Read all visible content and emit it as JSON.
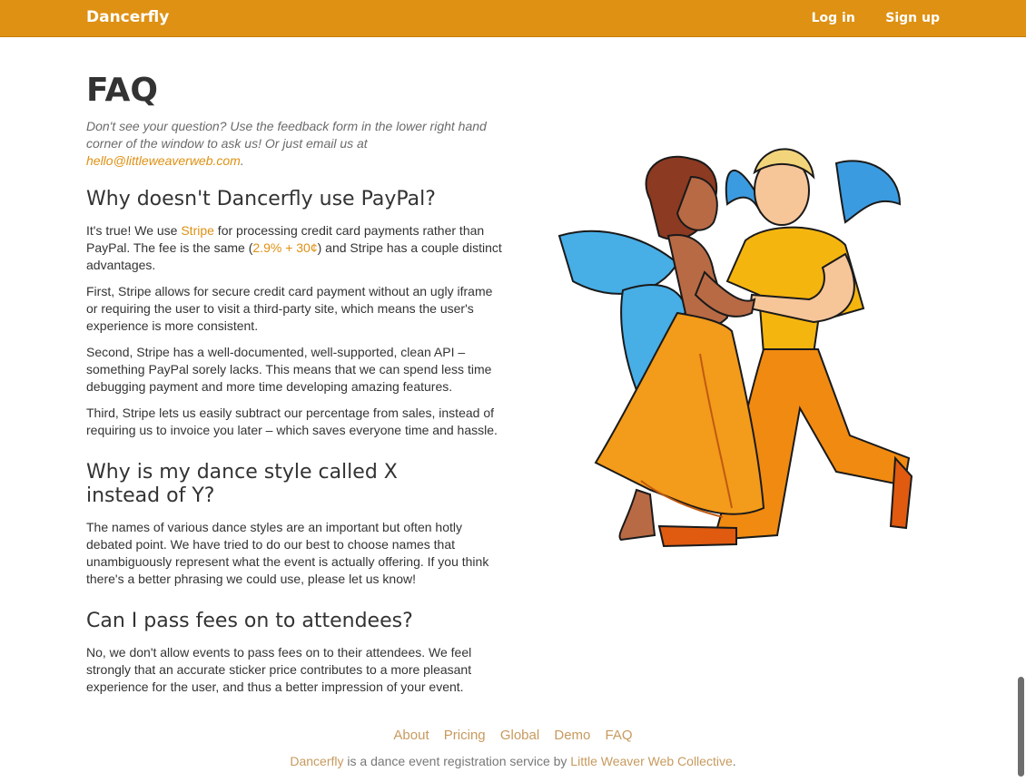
{
  "navbar": {
    "brand": "Dancerfly",
    "login": "Log in",
    "signup": "Sign up",
    "color": "#de9113"
  },
  "page": {
    "title": "FAQ",
    "lead_text": "Don't see your question? Use the feedback form in the lower right hand corner of the window to ask us! Or just email us at ",
    "lead_email": "hello@littleweaverweb.com",
    "lead_end": "."
  },
  "faq": [
    {
      "question": "Why doesn't Dancerfly use PayPal?",
      "p1_a": "It's true! We use ",
      "p1_link": "Stripe",
      "p1_b": " for processing credit card payments rather than PayPal. The fee is the same (",
      "p1_fee": "2.9% + 30¢",
      "p1_c": ") and Stripe has a couple distinct advantages.",
      "p2": "First, Stripe allows for secure credit card payment without an ugly iframe or requiring the user to visit a third-party site, which means the user's experience is more consistent.",
      "p3": "Second, Stripe has a well-documented, well-supported, clean API – something PayPal sorely lacks. This means that we can spend less time debugging payment and more time developing amazing features.",
      "p4": "Third, Stripe lets us easily subtract our percentage from sales, instead of requiring us to invoice you later – which saves everyone time and hassle."
    },
    {
      "question": "Why is my dance style called X instead of Y?",
      "p1": "The names of various dance styles are an important but often hotly debated point. We have tried to do our best to choose names that unambiguously represent what the event is actually offering. If you think there's a better phrasing we could use, please let us know!"
    },
    {
      "question": "Can I pass fees on to attendees?",
      "p1": "No, we don't allow events to pass fees on to their attendees. We feel strongly that an accurate sticker price contributes to a more pleasant experience for the user, and thus a better impression of your event."
    }
  ],
  "footer": {
    "links": [
      "About",
      "Pricing",
      "Global",
      "Demo",
      "FAQ"
    ],
    "brand_link": "Dancerfly",
    "note": " is a dance event registration service by ",
    "collective_link": "Little Weaver Web Collective",
    "note_end": "."
  }
}
